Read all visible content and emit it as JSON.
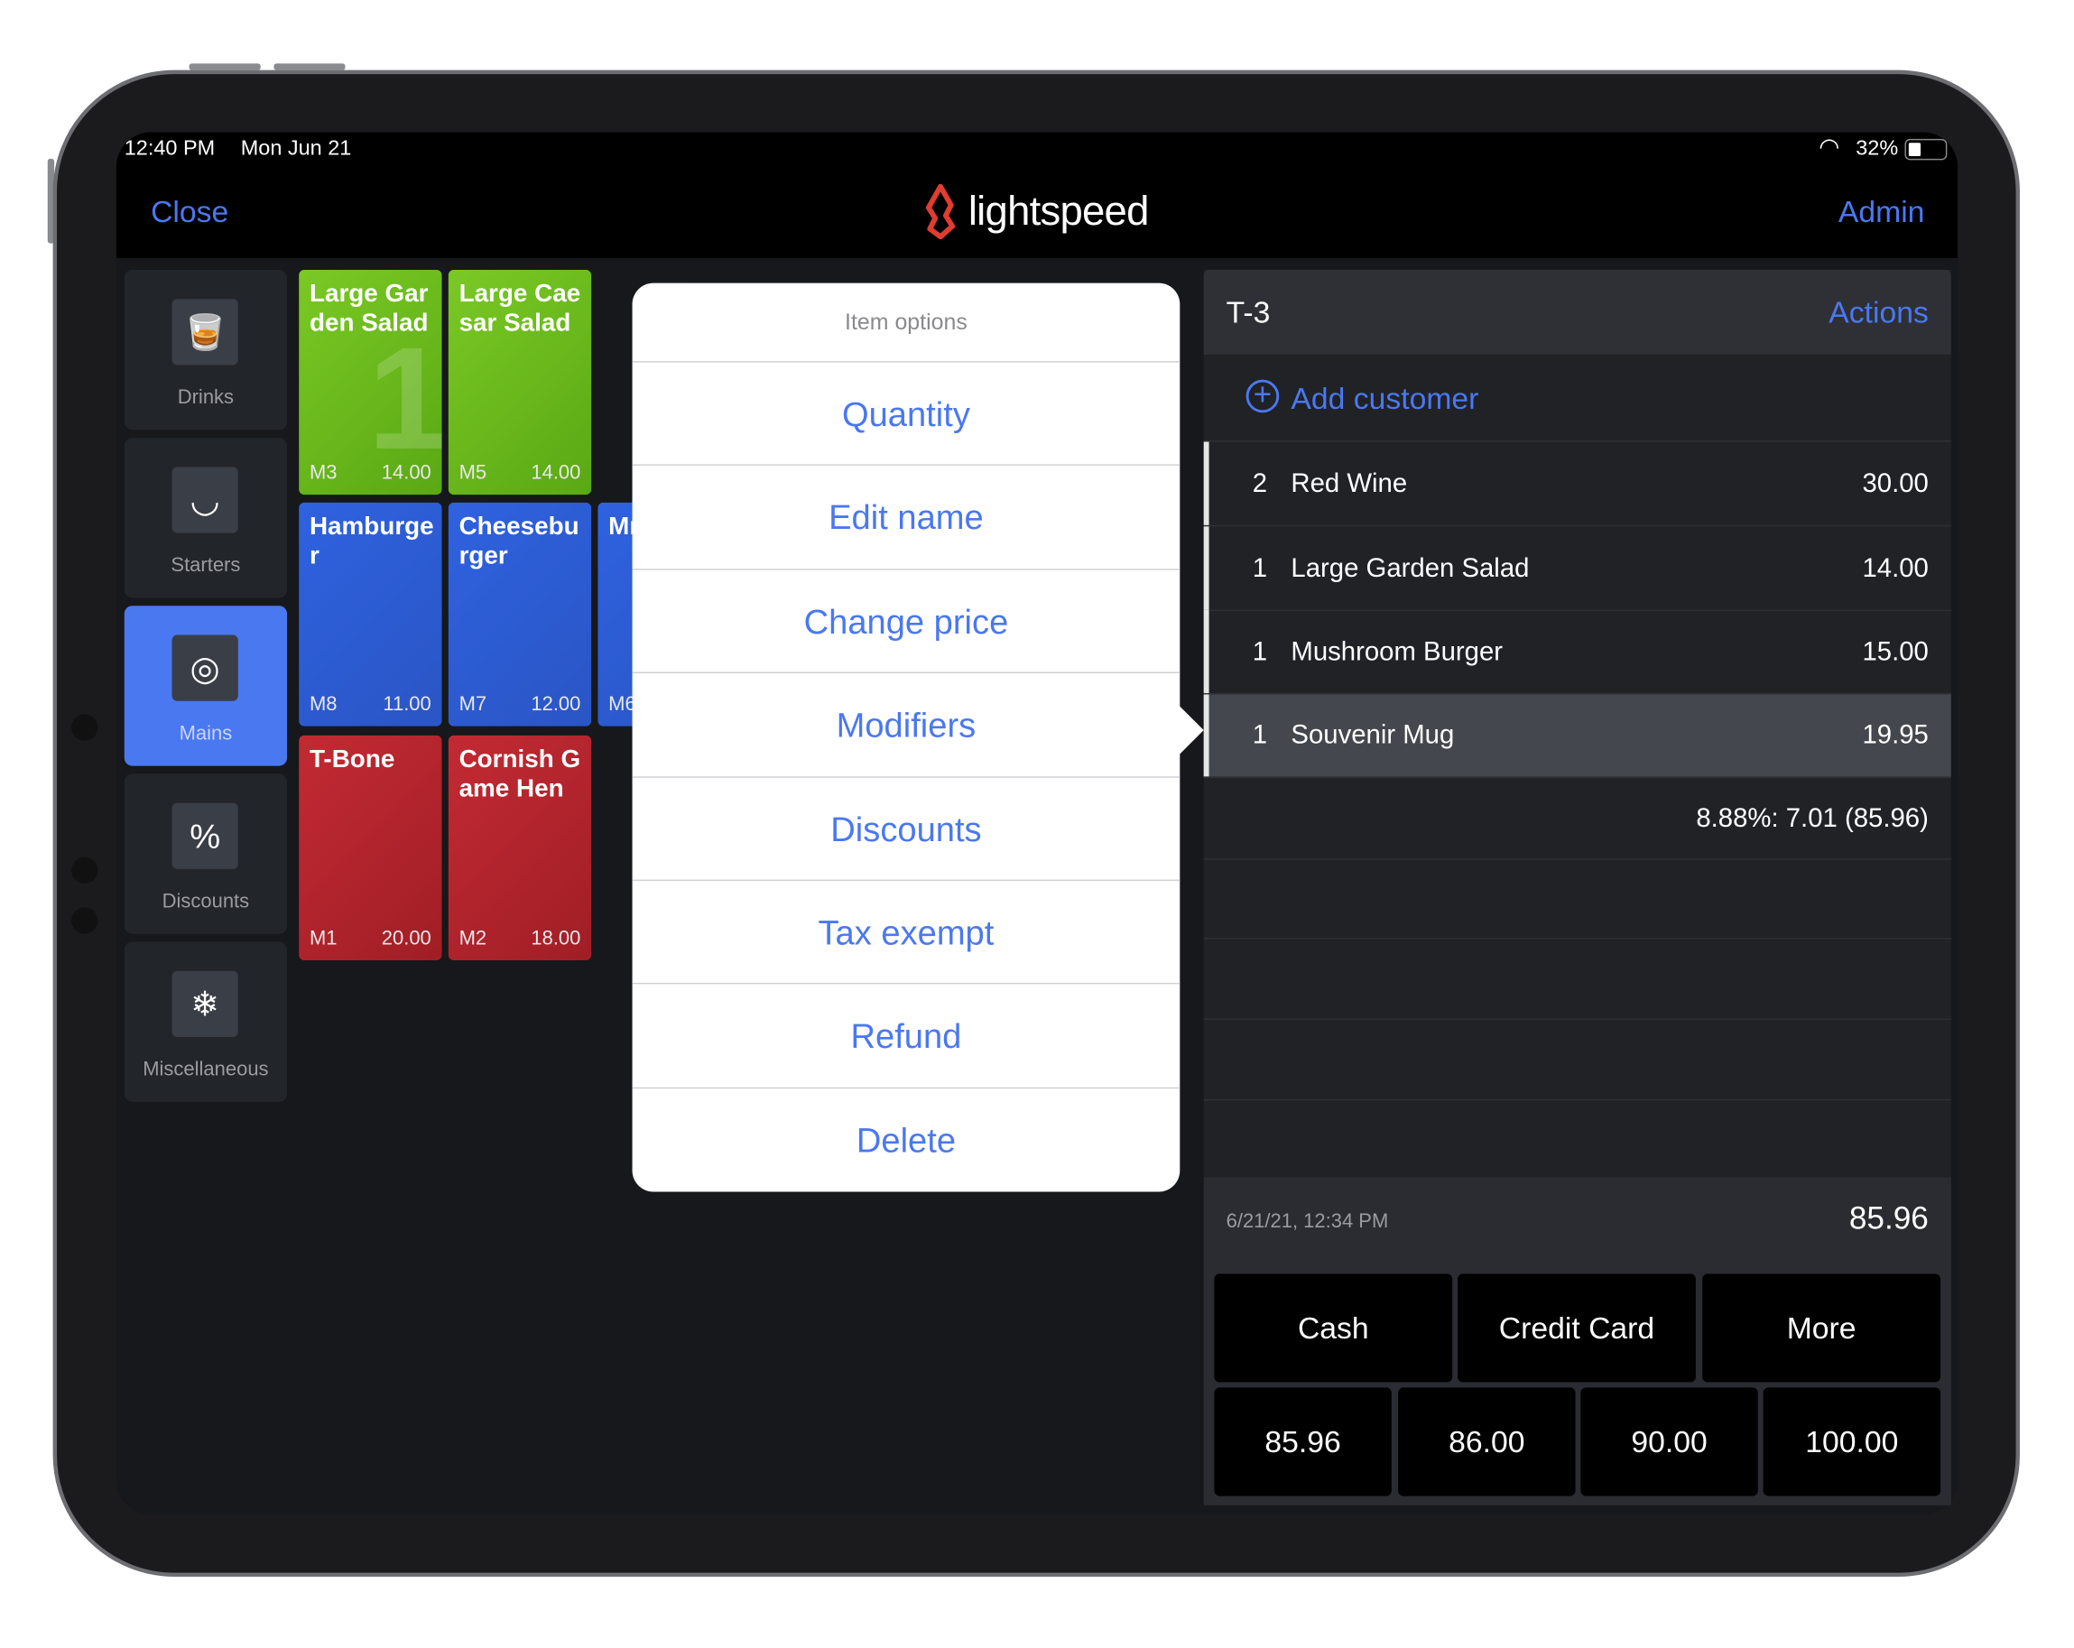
{
  "status_bar": {
    "time": "12:40 PM",
    "date": "Mon Jun 21",
    "battery": "32%",
    "battery_level": 0.32
  },
  "nav": {
    "close": "Close",
    "logo_text": "lightspeed",
    "admin": "Admin"
  },
  "sidebar": {
    "items": [
      {
        "label": "Drinks",
        "icon": "drinks-icon",
        "active": false
      },
      {
        "label": "Starters",
        "icon": "salad-bowl-icon",
        "active": false
      },
      {
        "label": "Mains",
        "icon": "plate-icon",
        "active": true
      },
      {
        "label": "Discounts",
        "icon": "percent-badge-icon",
        "active": false
      },
      {
        "label": "Miscellaneous",
        "icon": "snowflake-icon",
        "active": false
      }
    ]
  },
  "tiles": [
    {
      "name": "Large Garden Salad",
      "code": "M3",
      "price": "14.00",
      "color": "#6fbe20",
      "badge": "1"
    },
    {
      "name": "Large Caesar Salad",
      "code": "M5",
      "price": "14.00",
      "color": "#6fbe20"
    },
    {
      "name": "Hamburger",
      "code": "M8",
      "price": "11.00",
      "color": "#2f5fd8"
    },
    {
      "name": "Cheeseburger",
      "code": "M7",
      "price": "12.00",
      "color": "#2f5fd8"
    },
    {
      "name": "Mm",
      "code": "M6",
      "price": "",
      "color": "#2f5fd8"
    },
    {
      "name": "T-Bone",
      "code": "M1",
      "price": "20.00",
      "color": "#b3262e"
    },
    {
      "name": "Cornish Game Hen",
      "code": "M2",
      "price": "18.00",
      "color": "#b3262e"
    }
  ],
  "popover": {
    "title": "Item options",
    "options": [
      "Quantity",
      "Edit name",
      "Change price",
      "Modifiers",
      "Discounts",
      "Tax exempt",
      "Refund",
      "Delete"
    ]
  },
  "order": {
    "table": "T-3",
    "actions": "Actions",
    "add_customer": "Add customer",
    "items": [
      {
        "qty": "2",
        "name": "Red Wine",
        "price": "30.00",
        "selected": false
      },
      {
        "qty": "1",
        "name": "Large Garden Salad",
        "price": "14.00",
        "selected": false
      },
      {
        "qty": "1",
        "name": "Mushroom Burger",
        "price": "15.00",
        "selected": false
      },
      {
        "qty": "1",
        "name": "Souvenir Mug",
        "price": "19.95",
        "selected": true
      }
    ],
    "tax": "8.88%: 7.01 (85.96)",
    "timestamp": "6/21/21, 12:34 PM",
    "total": "85.96",
    "payment_methods": [
      "Cash",
      "Credit Card",
      "More"
    ],
    "quick_amounts": [
      "85.96",
      "86.00",
      "90.00",
      "100.00"
    ]
  },
  "colors": {
    "accent": "#4a78f0",
    "logo": "#e03c31"
  }
}
